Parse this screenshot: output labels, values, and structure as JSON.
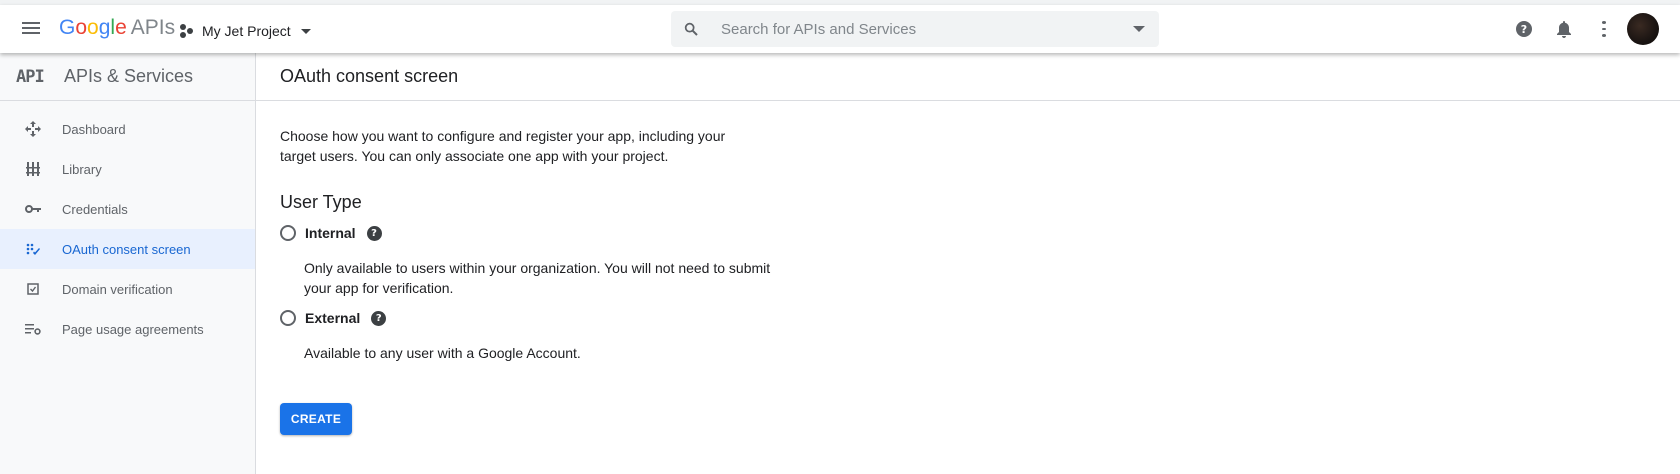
{
  "header": {
    "logo_google": "Google",
    "logo_apis": "APIs",
    "project_name": "My Jet Project",
    "search_placeholder": "Search for APIs and Services",
    "help_glyph": "?"
  },
  "sidebar": {
    "api_mark": "API",
    "title": "APIs & Services",
    "items": [
      {
        "label": "Dashboard",
        "icon": "dashboard-icon",
        "active": false
      },
      {
        "label": "Library",
        "icon": "library-icon",
        "active": false
      },
      {
        "label": "Credentials",
        "icon": "key-icon",
        "active": false
      },
      {
        "label": "OAuth consent screen",
        "icon": "consent-icon",
        "active": true
      },
      {
        "label": "Domain verification",
        "icon": "checkbox-icon",
        "active": false
      },
      {
        "label": "Page usage agreements",
        "icon": "settings-list-icon",
        "active": false
      }
    ]
  },
  "main": {
    "title": "OAuth consent screen",
    "description": "Choose how you want to configure and register your app, including your target users. You can only associate one app with your project.",
    "user_type_title": "User Type",
    "options": [
      {
        "label": "Internal",
        "description": "Only available to users within your organization. You will not need to submit your app for verification.",
        "selected": false
      },
      {
        "label": "External",
        "description": "Available to any user with a Google Account.",
        "selected": false
      }
    ],
    "create_label": "CREATE"
  },
  "colors": {
    "accent": "#1a73e8",
    "active_bg": "#e8f0fe",
    "active_text": "#1967d2"
  }
}
